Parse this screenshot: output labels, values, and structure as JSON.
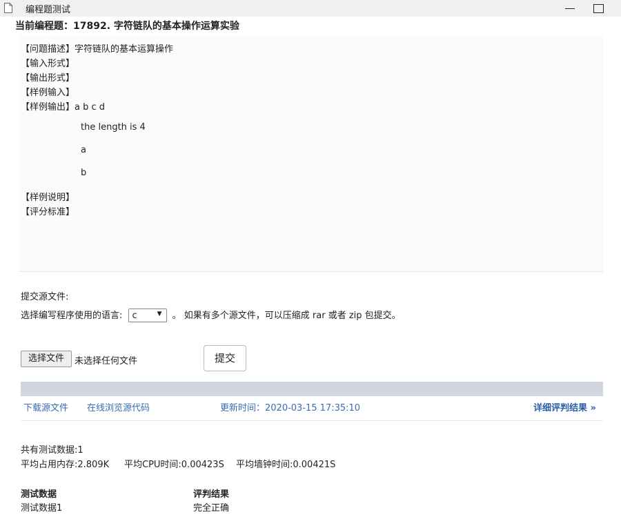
{
  "window": {
    "title": "编程题测试"
  },
  "problem": {
    "heading": "当前编程题：17892. 字符链队的基本操作运算实验",
    "description_label": "【问题描述】",
    "description_text": "字符链队的基本运算操作",
    "input_label": "【输入形式】",
    "output_label": "【输出形式】",
    "sample_input_label": "【样例输入】",
    "sample_output_label": "【样例输出】",
    "sample_output_first": "a b c d",
    "sample_output_lines": [
      "the length is 4",
      "a",
      "b"
    ],
    "sample_explain_label": "【样例说明】",
    "scoring_label": "【评分标准】"
  },
  "submission": {
    "submit_source_label": "提交源文件:",
    "lang_prefix": "选择编写程序使用的语言:",
    "lang_selected": "c",
    "lang_suffix": "。 如果有多个源文件，可以压缩成 rar 或者 zip 包提交。",
    "choose_file_button": "选择文件",
    "no_file_text": "未选择任何文件",
    "submit_button": "提交"
  },
  "result_bar": {
    "download_link": "下载源文件",
    "browse_link": "在线浏览源代码",
    "updated_time": "更新时间：2020-03-15 17:35:10",
    "detail_link": "详细评判结果 »"
  },
  "stats": {
    "total": "共有测试数据:1",
    "memory": "平均占用内存:2.809K",
    "cpu_time": "平均CPU时间:0.00423S",
    "wall_time": "平均墙钟时间:0.00421S"
  },
  "results_table": {
    "headers": [
      "测试数据",
      "评判结果"
    ],
    "rows": [
      [
        "测试数据1",
        "完全正确"
      ]
    ]
  },
  "colors": {
    "link": "#3a6db5",
    "band": "#d2d7df"
  }
}
